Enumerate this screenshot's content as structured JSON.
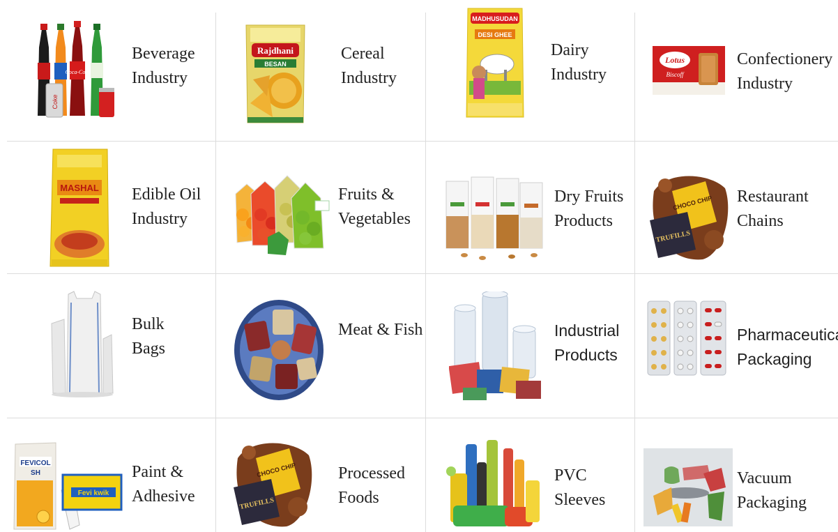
{
  "categories": [
    {
      "line1": "Beverage",
      "line2": "Industry",
      "icon": "beverage-bottles-icon"
    },
    {
      "line1": "Cereal",
      "line2": "Industry",
      "icon": "cereal-pouch-icon"
    },
    {
      "line1": "Dairy",
      "line2": "Industry",
      "icon": "ghee-pouch-icon"
    },
    {
      "line1": "Confectionery",
      "line2": "Industry",
      "icon": "biscuit-pack-icon"
    },
    {
      "line1": "Edible Oil",
      "line2": "Industry",
      "icon": "oil-pouch-icon"
    },
    {
      "line1": "Fruits &",
      "line2": "Vegetables",
      "icon": "mesh-produce-bags-icon"
    },
    {
      "line1": "Dry Fruits",
      "line2": "Products",
      "icon": "dry-fruit-pouches-icon"
    },
    {
      "line1": "Restaurant",
      "line2": "Chains",
      "icon": "chocolate-snack-packs-icon"
    },
    {
      "line1": "Bulk",
      "line2": "Bags",
      "icon": "bulk-bags-icon"
    },
    {
      "line1": "Meat & Fish",
      "line2": "",
      "icon": "vacuum-meat-icon"
    },
    {
      "line1": "Industrial",
      "line2": "Products",
      "icon": "stretch-film-rolls-icon"
    },
    {
      "line1": "Pharmaceutical",
      "line2": "Packaging",
      "icon": "blister-pack-icon"
    },
    {
      "line1": "Paint &",
      "line2": "Adhesive",
      "icon": "adhesive-pack-icon"
    },
    {
      "line1": "Processed",
      "line2": "Foods",
      "icon": "processed-foods-icon"
    },
    {
      "line1": "PVC",
      "line2": "Sleeves",
      "icon": "pvc-sleeve-rolls-icon"
    },
    {
      "line1": "Vacuum",
      "line2": "Packaging",
      "icon": "vacuum-pack-icon"
    }
  ],
  "product_text": {
    "rajdhani": "Rajdhani",
    "besan": "BESAN",
    "madhusudan": "MADHUSUDAN",
    "desi_ghee": "DESI GHEE",
    "lotus": "Lotus",
    "biscoff": "Biscoff",
    "mashal": "MASHAL",
    "choco_chip": "CHOCO CHIP",
    "trufills": "TRUFILLS",
    "fevicol": "FEVICOL",
    "sh": "SH",
    "fevikwik": "Fevi kwik",
    "coke": "Coke"
  }
}
